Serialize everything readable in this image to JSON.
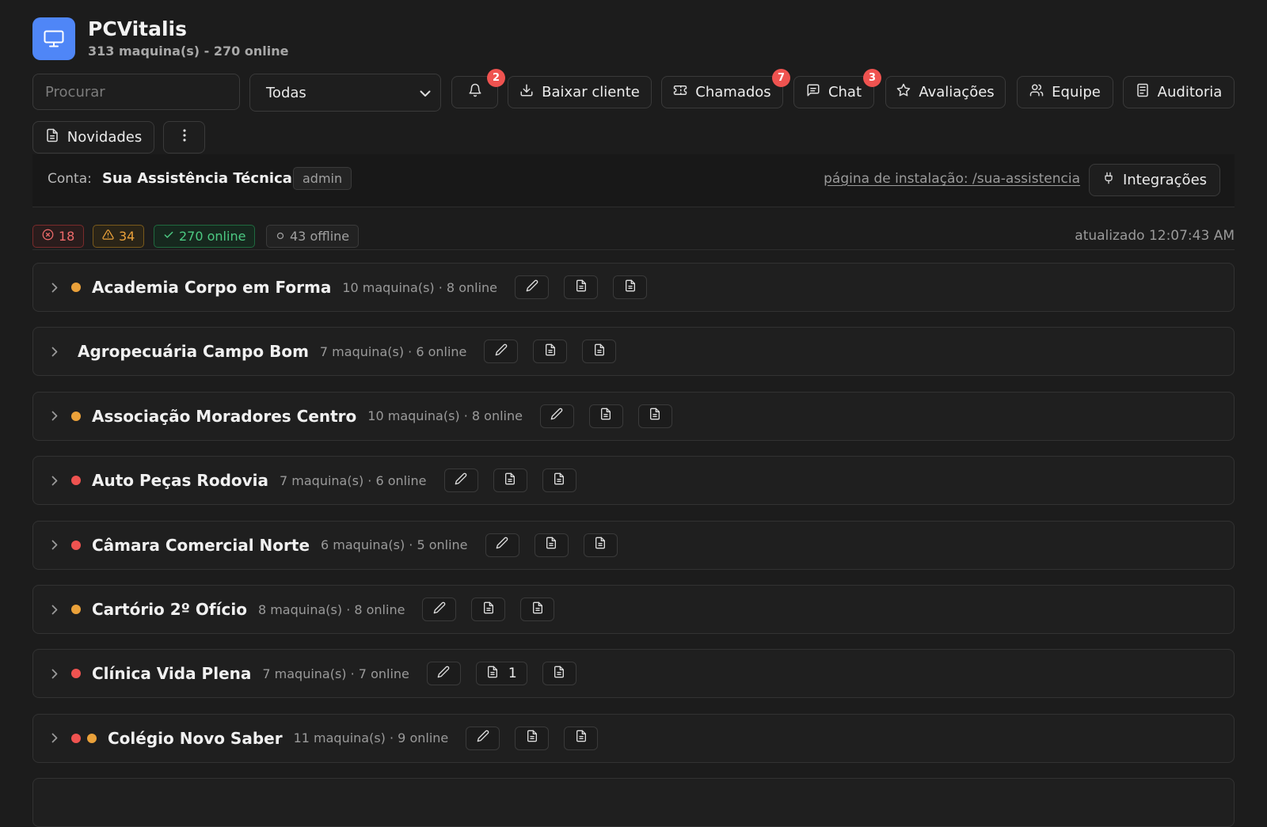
{
  "app": {
    "title": "PCVitalis",
    "subtitle": "313 maquina(s) - 270 online",
    "logo_icon": "monitor-icon",
    "accent": "#4f86f7"
  },
  "toolbar": {
    "search_placeholder": "Procurar",
    "filter_value": "Todas",
    "notifications_badge": "2",
    "download_label": "Baixar cliente",
    "tickets_label": "Chamados",
    "tickets_badge": "7",
    "chat_label": "Chat",
    "chat_badge": "3",
    "reviews_label": "Avaliações",
    "team_label": "Equipe",
    "audit_label": "Auditoria",
    "news_label": "Novidades",
    "more_icon": "more-vertical-icon"
  },
  "account": {
    "label": "Conta:",
    "name": "Sua Assistência Técnica",
    "role": "admin",
    "install_link": "página de instalação: /sua-assistencia",
    "integrations_label": "Integrações"
  },
  "status": {
    "errors": "18",
    "warnings": "34",
    "online": "270 online",
    "offline": "43 offline",
    "updated": "atualizado 12:07:43 AM",
    "colors": {
      "error": "#ef5350",
      "warning": "#eaa13a",
      "online": "#4cc982"
    }
  },
  "groups": [
    {
      "name": "Academia Corpo em Forma",
      "meta": "10 maquina(s) · 8 online",
      "dots": [
        "warn"
      ],
      "report_count": ""
    },
    {
      "name": "Agropecuária Campo Bom",
      "meta": "7 maquina(s) · 6 online",
      "dots": [],
      "report_count": ""
    },
    {
      "name": "Associação Moradores Centro",
      "meta": "10 maquina(s) · 8 online",
      "dots": [
        "warn"
      ],
      "report_count": ""
    },
    {
      "name": "Auto Peças Rodovia",
      "meta": "7 maquina(s) · 6 online",
      "dots": [
        "error"
      ],
      "report_count": ""
    },
    {
      "name": "Câmara Comercial Norte",
      "meta": "6 maquina(s) · 5 online",
      "dots": [
        "error"
      ],
      "report_count": ""
    },
    {
      "name": "Cartório 2º Ofício",
      "meta": "8 maquina(s) · 8 online",
      "dots": [
        "warn"
      ],
      "report_count": ""
    },
    {
      "name": "Clínica Vida Plena",
      "meta": "7 maquina(s) · 7 online",
      "dots": [
        "error"
      ],
      "report_count": "1"
    },
    {
      "name": "Colégio Novo Saber",
      "meta": "11 maquina(s) · 9 online",
      "dots": [
        "error",
        "warn"
      ],
      "report_count": ""
    }
  ]
}
